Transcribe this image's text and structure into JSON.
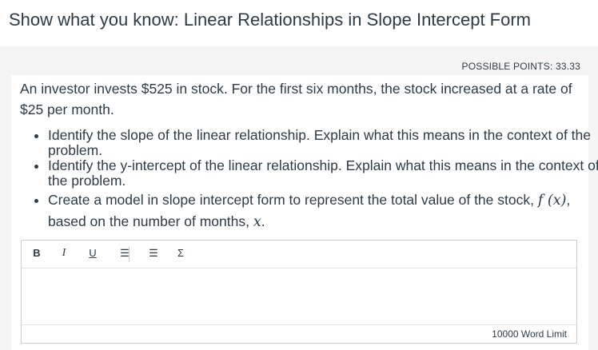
{
  "header": {
    "title": "Show what you know: Linear Relationships in Slope Intercept Form"
  },
  "question": {
    "points_label": "POSSIBLE POINTS: 33.33",
    "intro": "An investor invests $525 in stock. For the first six months, the stock increased at a rate of $25 per month.",
    "bullets": [
      "Identify the slope of the linear relationship. Explain what this means in the context of the problem.",
      "Identify the y-intercept of the linear relationship. Explain what this means in the context of the problem."
    ],
    "bullet3": {
      "text_a": "Create a model in slope intercept form to represent the total value of the stock, ",
      "math_f": "f",
      "math_paren": " (x)",
      "text_b": ", based on the number of months, ",
      "math_x": "x",
      "text_c": "."
    }
  },
  "editor": {
    "toolbar": {
      "bold": "B",
      "italic": "I",
      "underline": "U",
      "bullet_list": "☰",
      "numbered_list": "☰",
      "math": "Σ"
    },
    "word_limit": "10000 Word Limit"
  }
}
